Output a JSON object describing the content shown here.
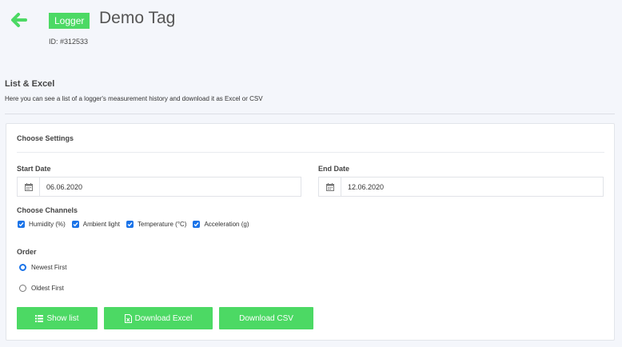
{
  "header": {
    "badge": "Logger",
    "title": "Demo Tag",
    "id_text": "ID: #312533"
  },
  "section": {
    "title": "List & Excel",
    "description": "Here you can see a list of a logger's measurement history and download it as Excel or CSV"
  },
  "settings": {
    "title": "Choose Settings",
    "start_date_label": "Start Date",
    "start_date_value": "06.06.2020",
    "end_date_label": "End Date",
    "end_date_value": "12.06.2020",
    "channels_label": "Choose Channels",
    "channels": [
      {
        "label": "Humidity (%)",
        "checked": true
      },
      {
        "label": "Ambient light",
        "checked": true
      },
      {
        "label": "Temperature (°C)",
        "checked": true
      },
      {
        "label": "Acceleration (g)",
        "checked": true
      }
    ],
    "order_label": "Order",
    "order_options": [
      {
        "label": "Newest First",
        "selected": true
      },
      {
        "label": "Oldest First",
        "selected": false
      }
    ]
  },
  "buttons": {
    "show_list": "Show list",
    "download_excel": "Download Excel",
    "download_csv": "Download CSV"
  },
  "colors": {
    "accent_green": "#4cd964",
    "checkbox_blue": "#1a73e8",
    "background": "#f4f6fb"
  }
}
